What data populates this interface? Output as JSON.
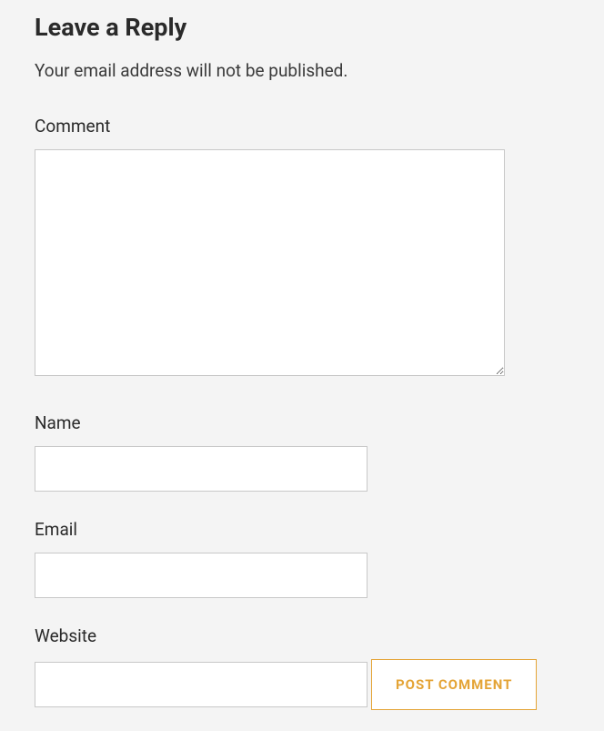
{
  "heading": "Leave a Reply",
  "note": "Your email address will not be published.",
  "fields": {
    "comment_label": "Comment",
    "name_label": "Name",
    "email_label": "Email",
    "website_label": "Website"
  },
  "submit_label": "POST COMMENT"
}
